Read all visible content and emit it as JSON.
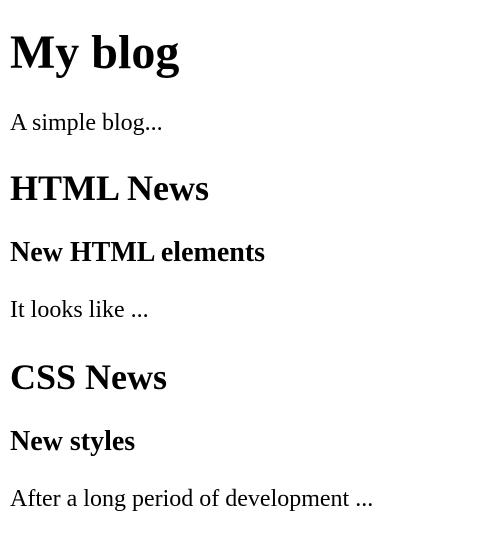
{
  "blog": {
    "title": "My blog",
    "subtitle": "A simple blog..."
  },
  "sections": [
    {
      "title": "HTML News",
      "article": {
        "title": "New HTML elements",
        "excerpt": "It looks like ..."
      }
    },
    {
      "title": "CSS News",
      "article": {
        "title": "New styles",
        "excerpt": "After a long period of development ..."
      }
    }
  ]
}
